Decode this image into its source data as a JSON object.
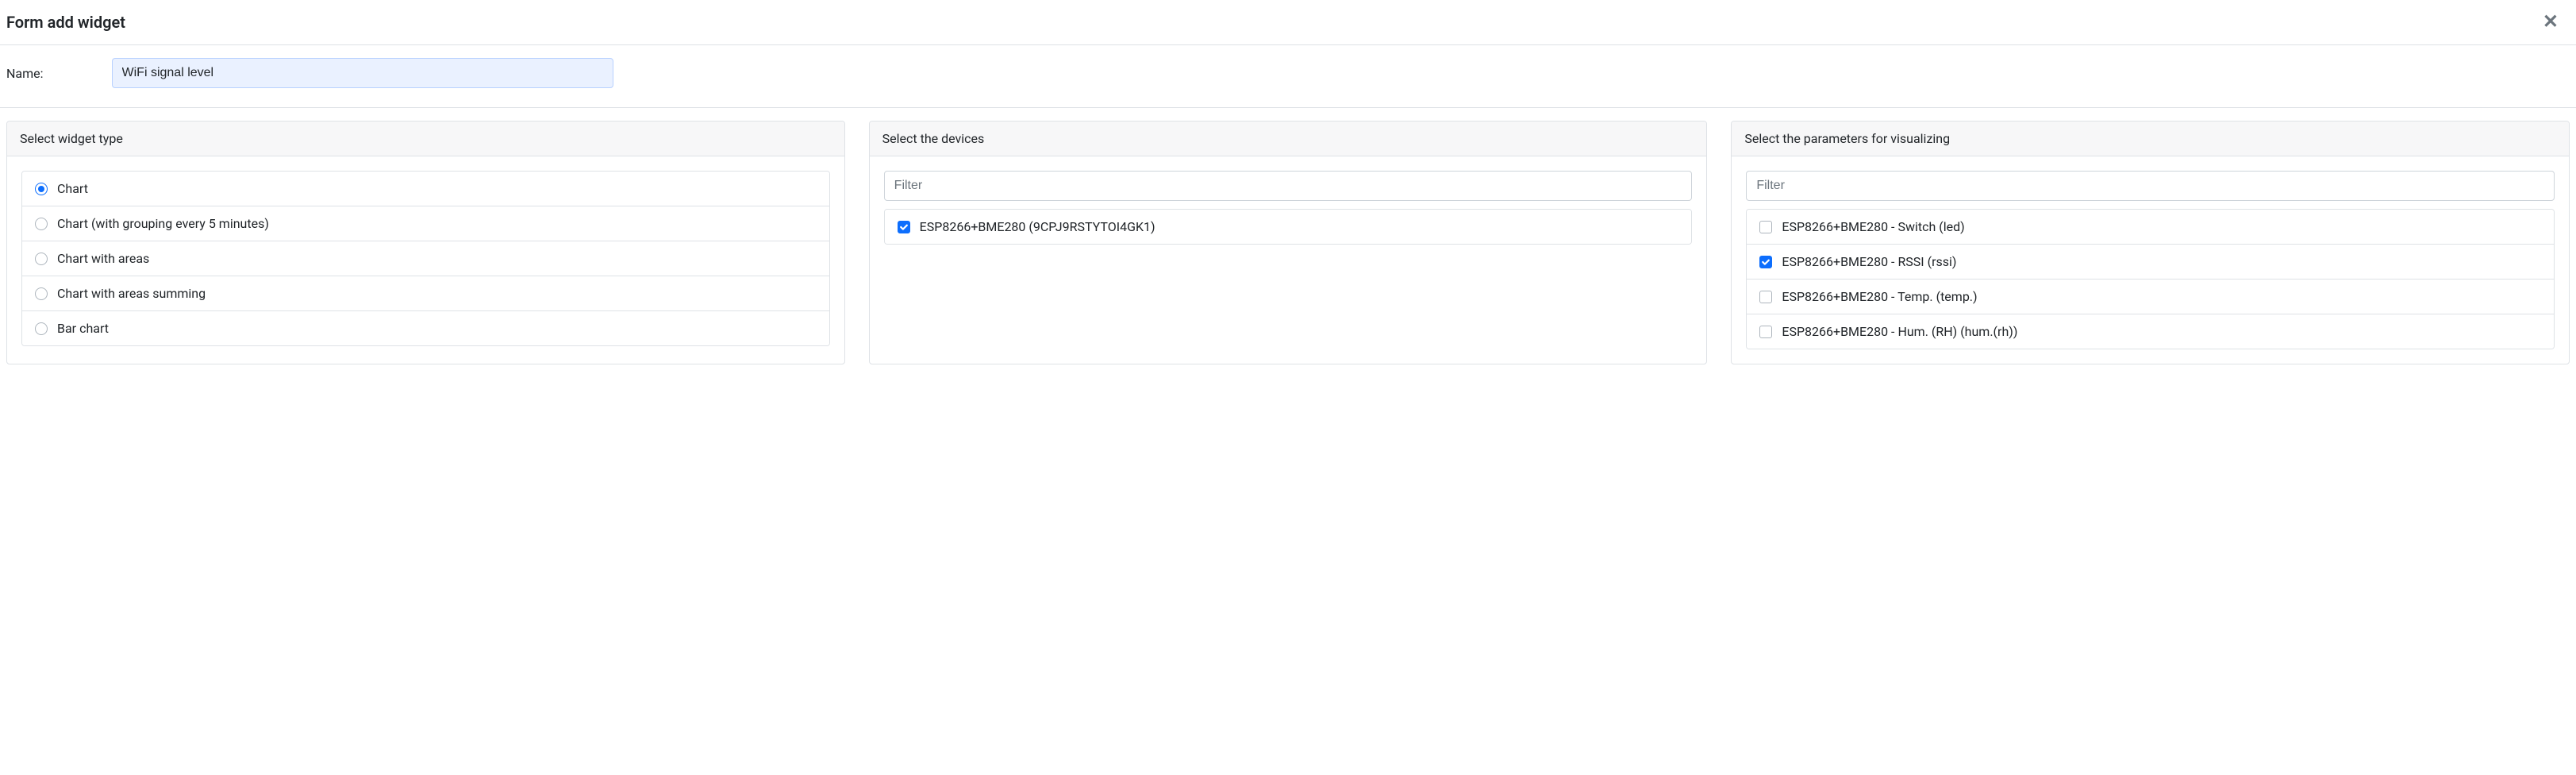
{
  "header": {
    "title": "Form add widget"
  },
  "name": {
    "label": "Name:",
    "value": "WiFi signal level"
  },
  "panels": {
    "widget_type": {
      "title": "Select widget type",
      "options": [
        {
          "label": "Chart",
          "checked": true
        },
        {
          "label": "Chart (with grouping every 5 minutes)",
          "checked": false
        },
        {
          "label": "Chart with areas",
          "checked": false
        },
        {
          "label": "Chart with areas summing",
          "checked": false
        },
        {
          "label": "Bar chart",
          "checked": false
        }
      ]
    },
    "devices": {
      "title": "Select the devices",
      "filter_placeholder": "Filter",
      "items": [
        {
          "label": "ESP8266+BME280 (9CPJ9RSTYTOI4GK1)",
          "checked": true
        }
      ]
    },
    "parameters": {
      "title": "Select the parameters for visualizing",
      "filter_placeholder": "Filter",
      "items": [
        {
          "label": "ESP8266+BME280 - Switch (led)",
          "checked": false
        },
        {
          "label": "ESP8266+BME280 - RSSI (rssi)",
          "checked": true
        },
        {
          "label": "ESP8266+BME280 - Temp. (temp.)",
          "checked": false
        },
        {
          "label": "ESP8266+BME280 - Hum. (RH) (hum.(rh))",
          "checked": false
        }
      ]
    }
  }
}
